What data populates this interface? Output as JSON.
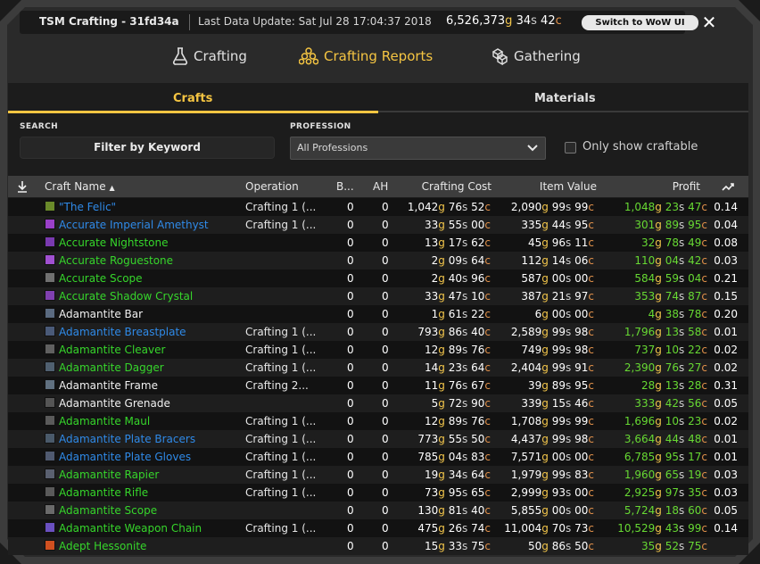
{
  "title_bar": {
    "app_title": "TSM Crafting - 31fd34a",
    "data_update": "Last Data Update: Sat Jul 28 17:04:37 2018",
    "gold": {
      "g": "6,526,373",
      "s": "34",
      "c": "42"
    },
    "switch_button": "Switch to WoW UI",
    "close_icon": "✕"
  },
  "main_tabs": [
    {
      "label": "Crafting",
      "icon": "flask-icon",
      "active": false
    },
    {
      "label": "Crafting Reports",
      "icon": "pyramid-icon",
      "active": true
    },
    {
      "label": "Gathering",
      "icon": "cubes-icon",
      "active": false
    }
  ],
  "sub_tabs": [
    {
      "label": "Crafts",
      "active": true
    },
    {
      "label": "Materials",
      "active": false
    }
  ],
  "filters": {
    "search_label": "SEARCH",
    "search_placeholder": "Filter by Keyword",
    "profession_label": "PROFESSION",
    "profession_value": "All Professions",
    "craftable_label": "Only show craftable",
    "craftable_checked": false
  },
  "table": {
    "columns": [
      "Craft Name",
      "Operation",
      "B...",
      "AH",
      "Crafting Cost",
      "Item Value",
      "Profit"
    ],
    "sort_icon": "download-icon",
    "sort_indicator": "▲",
    "ratio_icon": "trend-icon",
    "colors": {
      "rare": "#2f8ae8",
      "uncommon": "#36d62b",
      "common": "#f0f0f0",
      "profit": "#67d933",
      "gold": "#f2c54b",
      "silver": "#d0d0d0",
      "copper": "#e0904a"
    },
    "rows": [
      {
        "name": "\"The Felic\"",
        "quality": "rare",
        "icon_color": "#6a8a2a",
        "operation": "Crafting 1 (...",
        "b": "0",
        "ah": "0",
        "cost": [
          "1,042",
          "76",
          "52"
        ],
        "value": [
          "2,090",
          "99",
          "99"
        ],
        "profit": [
          "1,048",
          "23",
          "47"
        ],
        "ratio": "0.14"
      },
      {
        "name": "Accurate Imperial Amethyst",
        "quality": "rare",
        "icon_color": "#9a40c8",
        "operation": "Crafting 1 (...",
        "b": "0",
        "ah": "0",
        "cost": [
          "33",
          "55",
          "00"
        ],
        "value": [
          "335",
          "44",
          "95"
        ],
        "profit": [
          "301",
          "89",
          "95"
        ],
        "ratio": "0.04"
      },
      {
        "name": "Accurate Nightstone",
        "quality": "unc",
        "icon_color": "#7a3ab0",
        "operation": "",
        "b": "0",
        "ah": "0",
        "cost": [
          "13",
          "17",
          "62"
        ],
        "value": [
          "45",
          "96",
          "11"
        ],
        "profit": [
          "32",
          "78",
          "49"
        ],
        "ratio": "0.08"
      },
      {
        "name": "Accurate Roguestone",
        "quality": "unc",
        "icon_color": "#a050d0",
        "operation": "",
        "b": "0",
        "ah": "0",
        "cost": [
          "2",
          "09",
          "64"
        ],
        "value": [
          "112",
          "14",
          "06"
        ],
        "profit": [
          "110",
          "04",
          "42"
        ],
        "ratio": "0.03"
      },
      {
        "name": "Accurate Scope",
        "quality": "unc",
        "icon_color": "#707070",
        "operation": "",
        "b": "0",
        "ah": "0",
        "cost": [
          "2",
          "40",
          "96"
        ],
        "value": [
          "587",
          "00",
          "00"
        ],
        "profit": [
          "584",
          "59",
          "04"
        ],
        "ratio": "0.21"
      },
      {
        "name": "Accurate Shadow Crystal",
        "quality": "unc",
        "icon_color": "#8040b0",
        "operation": "",
        "b": "0",
        "ah": "0",
        "cost": [
          "33",
          "47",
          "10"
        ],
        "value": [
          "387",
          "21",
          "97"
        ],
        "profit": [
          "353",
          "74",
          "87"
        ],
        "ratio": "0.15"
      },
      {
        "name": "Adamantite Bar",
        "quality": "com",
        "icon_color": "#5a6a80",
        "operation": "",
        "b": "0",
        "ah": "0",
        "cost": [
          "1",
          "61",
          "22"
        ],
        "value": [
          "6",
          "00",
          "00"
        ],
        "profit": [
          "4",
          "38",
          "78"
        ],
        "ratio": "0.20"
      },
      {
        "name": "Adamantite Breastplate",
        "quality": "rare",
        "icon_color": "#4a5a78",
        "operation": "Crafting 1 (...",
        "b": "0",
        "ah": "0",
        "cost": [
          "793",
          "86",
          "40"
        ],
        "value": [
          "2,589",
          "99",
          "98"
        ],
        "profit": [
          "1,796",
          "13",
          "58"
        ],
        "ratio": "0.01"
      },
      {
        "name": "Adamantite Cleaver",
        "quality": "unc",
        "icon_color": "#606060",
        "operation": "Crafting 1 (...",
        "b": "0",
        "ah": "0",
        "cost": [
          "12",
          "89",
          "76"
        ],
        "value": [
          "749",
          "99",
          "98"
        ],
        "profit": [
          "737",
          "10",
          "22"
        ],
        "ratio": "0.02"
      },
      {
        "name": "Adamantite Dagger",
        "quality": "unc",
        "icon_color": "#506070",
        "operation": "Crafting 1 (...",
        "b": "0",
        "ah": "0",
        "cost": [
          "14",
          "23",
          "64"
        ],
        "value": [
          "2,404",
          "99",
          "91"
        ],
        "profit": [
          "2,390",
          "76",
          "27"
        ],
        "ratio": "0.02"
      },
      {
        "name": "Adamantite Frame",
        "quality": "com",
        "icon_color": "#607080",
        "operation": "Crafting 2...",
        "b": "0",
        "ah": "0",
        "cost": [
          "11",
          "76",
          "67"
        ],
        "value": [
          "39",
          "89",
          "95"
        ],
        "profit": [
          "28",
          "13",
          "28"
        ],
        "ratio": "0.31"
      },
      {
        "name": "Adamantite Grenade",
        "quality": "com",
        "icon_color": "#555555",
        "operation": "",
        "b": "0",
        "ah": "0",
        "cost": [
          "5",
          "72",
          "90"
        ],
        "value": [
          "339",
          "15",
          "46"
        ],
        "profit": [
          "333",
          "42",
          "56"
        ],
        "ratio": "0.05"
      },
      {
        "name": "Adamantite Maul",
        "quality": "unc",
        "icon_color": "#5a5a5a",
        "operation": "Crafting 1 (...",
        "b": "0",
        "ah": "0",
        "cost": [
          "12",
          "89",
          "76"
        ],
        "value": [
          "1,708",
          "99",
          "99"
        ],
        "profit": [
          "1,696",
          "10",
          "23"
        ],
        "ratio": "0.02"
      },
      {
        "name": "Adamantite Plate Bracers",
        "quality": "rare",
        "icon_color": "#4a5a6a",
        "operation": "Crafting 1 (...",
        "b": "0",
        "ah": "0",
        "cost": [
          "773",
          "55",
          "50"
        ],
        "value": [
          "4,437",
          "99",
          "98"
        ],
        "profit": [
          "3,664",
          "44",
          "48"
        ],
        "ratio": "0.01"
      },
      {
        "name": "Adamantite Plate Gloves",
        "quality": "rare",
        "icon_color": "#505a70",
        "operation": "Crafting 1 (...",
        "b": "0",
        "ah": "0",
        "cost": [
          "785",
          "04",
          "83"
        ],
        "value": [
          "7,571",
          "00",
          "00"
        ],
        "profit": [
          "6,785",
          "95",
          "17"
        ],
        "ratio": "0.01"
      },
      {
        "name": "Adamantite Rapier",
        "quality": "unc",
        "icon_color": "#5a6070",
        "operation": "Crafting 1 (...",
        "b": "0",
        "ah": "0",
        "cost": [
          "19",
          "34",
          "64"
        ],
        "value": [
          "1,979",
          "99",
          "83"
        ],
        "profit": [
          "1,960",
          "65",
          "19"
        ],
        "ratio": "0.03"
      },
      {
        "name": "Adamantite Rifle",
        "quality": "unc",
        "icon_color": "#5a5a5a",
        "operation": "Crafting 1 (...",
        "b": "0",
        "ah": "0",
        "cost": [
          "73",
          "95",
          "65"
        ],
        "value": [
          "2,999",
          "93",
          "00"
        ],
        "profit": [
          "2,925",
          "97",
          "35"
        ],
        "ratio": "0.03"
      },
      {
        "name": "Adamantite Scope",
        "quality": "unc",
        "icon_color": "#6a6a6a",
        "operation": "",
        "b": "0",
        "ah": "0",
        "cost": [
          "130",
          "81",
          "40"
        ],
        "value": [
          "5,855",
          "00",
          "00"
        ],
        "profit": [
          "5,724",
          "18",
          "60"
        ],
        "ratio": "0.05"
      },
      {
        "name": "Adamantite Weapon Chain",
        "quality": "unc",
        "icon_color": "#6a50c0",
        "operation": "Crafting 1 (...",
        "b": "0",
        "ah": "0",
        "cost": [
          "475",
          "26",
          "74"
        ],
        "value": [
          "11,004",
          "70",
          "73"
        ],
        "profit": [
          "10,529",
          "43",
          "99"
        ],
        "ratio": "0.14"
      },
      {
        "name": "Adept Hessonite",
        "quality": "unc",
        "icon_color": "#d05020",
        "operation": "",
        "b": "0",
        "ah": "0",
        "cost": [
          "15",
          "33",
          "75"
        ],
        "value": [
          "50",
          "86",
          "50"
        ],
        "profit": [
          "35",
          "52",
          "75"
        ],
        "ratio": ""
      }
    ]
  }
}
